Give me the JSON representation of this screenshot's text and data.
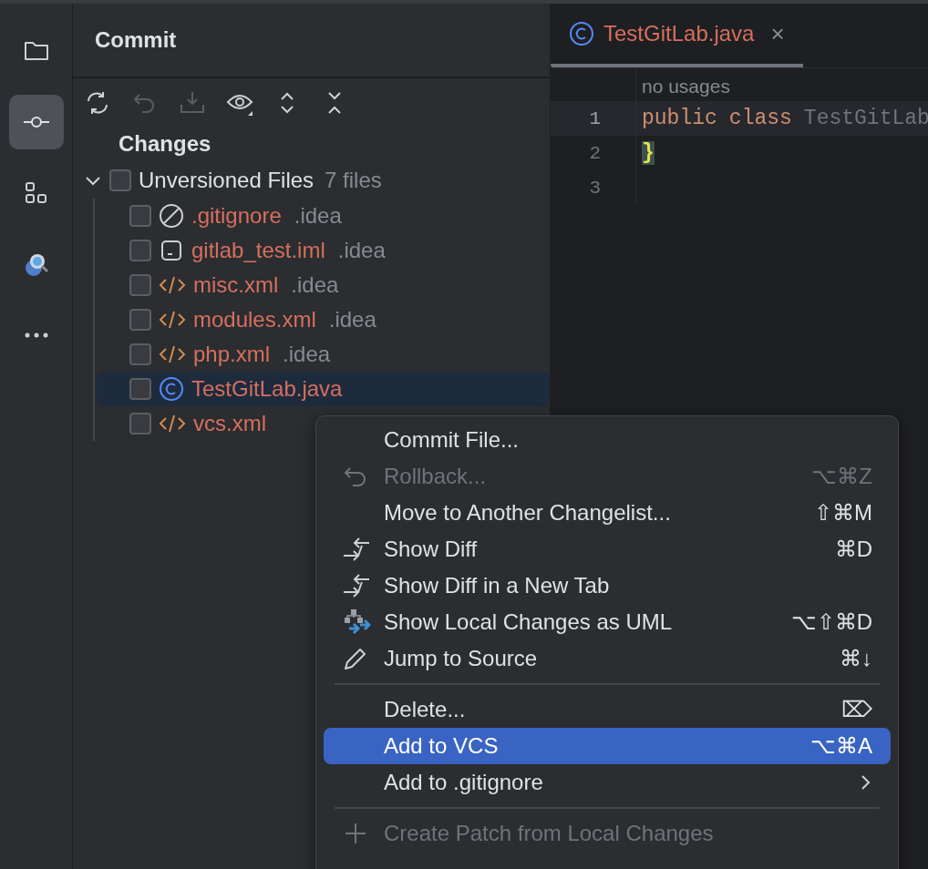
{
  "sidebar": {
    "items": [
      {
        "kind": "folder",
        "selected": false
      },
      {
        "kind": "commit",
        "selected": true
      },
      {
        "kind": "structure",
        "selected": false
      },
      {
        "kind": "plugin",
        "selected": false
      },
      {
        "kind": "more",
        "selected": false
      }
    ]
  },
  "commit_panel": {
    "title": "Commit",
    "toolbar": [
      {
        "kind": "refresh",
        "disabled": false
      },
      {
        "kind": "rollback",
        "disabled": true
      },
      {
        "kind": "shelve",
        "disabled": true
      },
      {
        "kind": "view",
        "disabled": false
      },
      {
        "kind": "expand",
        "disabled": false
      },
      {
        "kind": "collapse",
        "disabled": false
      }
    ],
    "section": "Changes",
    "group": {
      "label": "Unversioned Files",
      "count": "7 files",
      "expanded": true,
      "checked": false,
      "children": [
        {
          "name": ".gitignore",
          "dir": ".idea",
          "kind": "ignore",
          "checked": false,
          "selected": false
        },
        {
          "name": "gitlab_test.iml",
          "dir": ".idea",
          "kind": "module",
          "checked": false,
          "selected": false
        },
        {
          "name": "misc.xml",
          "dir": ".idea",
          "kind": "xml",
          "checked": false,
          "selected": false
        },
        {
          "name": "modules.xml",
          "dir": ".idea",
          "kind": "xml",
          "checked": false,
          "selected": false
        },
        {
          "name": "php.xml",
          "dir": ".idea",
          "kind": "xml",
          "checked": false,
          "selected": false
        },
        {
          "name": "TestGitLab.java",
          "kind": "class",
          "checked": false,
          "selected": true
        },
        {
          "name": "vcs.xml",
          "kind": "xml",
          "checked": false,
          "selected": false
        }
      ]
    }
  },
  "editor": {
    "tabs": [
      {
        "name": "TestGitLab.java",
        "kind": "class",
        "close": "×",
        "selected": true
      }
    ],
    "hint": "no usages",
    "lines": [
      {
        "number": "1",
        "current": true,
        "tokens": [
          {
            "text": "public",
            "kind": "keyword"
          },
          {
            "text": "class",
            "kind": "keyword"
          },
          {
            "text": "TestGitLab",
            "kind": "plain"
          }
        ]
      },
      {
        "number": "2",
        "current": false,
        "tokens": [
          {
            "text": "}",
            "kind": "brace",
            "matched": true
          }
        ]
      },
      {
        "number": "3",
        "current": false
      }
    ]
  },
  "context_menu": {
    "items": [
      {
        "kind": "plain",
        "label": "Commit File...",
        "disabled": false,
        "selected": false
      },
      {
        "kind": "rollback",
        "label": "Rollback...",
        "shortcut": "⌥⌘Z",
        "disabled": true,
        "selected": false
      },
      {
        "kind": "plain",
        "label": "Move to Another Changelist...",
        "shortcut": "⇧⌘M",
        "disabled": false,
        "selected": false
      },
      {
        "kind": "diff",
        "label": "Show Diff",
        "shortcut": "⌘D",
        "disabled": false,
        "selected": false
      },
      {
        "kind": "diff",
        "label": "Show Diff in a New Tab",
        "disabled": false,
        "selected": false
      },
      {
        "kind": "uml",
        "label": "Show Local Changes as UML",
        "shortcut": "⌥⇧⌘D",
        "disabled": false,
        "selected": false
      },
      {
        "kind": "pencil",
        "label": "Jump to Source",
        "shortcut": "⌘↓",
        "disabled": false,
        "selected": false
      },
      {
        "kind": "separator"
      },
      {
        "kind": "plain",
        "label": "Delete...",
        "shortcut": "⌦",
        "disabled": false,
        "selected": false
      },
      {
        "kind": "plain",
        "label": "Add to VCS",
        "shortcut": "⌥⌘A",
        "disabled": false,
        "selected": true
      },
      {
        "kind": "plain",
        "label": "Add to .gitignore",
        "submenu": true,
        "disabled": false,
        "selected": false
      },
      {
        "kind": "separator"
      },
      {
        "kind": "plus",
        "label": "Create Patch from Local Changes",
        "disabled": true,
        "selected": false
      }
    ]
  }
}
